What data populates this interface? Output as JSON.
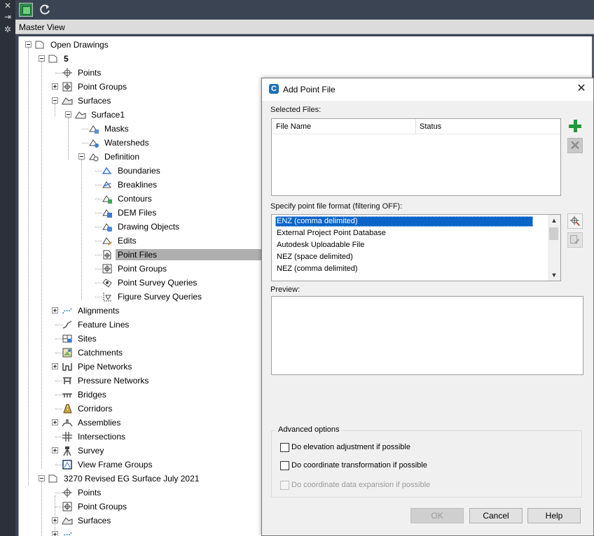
{
  "toolbar": {
    "icons": [
      "view-icon",
      "refresh-icon"
    ]
  },
  "master_view": {
    "title": "Master View"
  },
  "tree": {
    "open_drawings": "Open Drawings",
    "drawing1": "5",
    "points": "Points",
    "point_groups": "Point Groups",
    "surfaces": "Surfaces",
    "surface1": "Surface1",
    "masks": "Masks",
    "watersheds": "Watersheds",
    "definition": "Definition",
    "boundaries": "Boundaries",
    "breaklines": "Breaklines",
    "contours": "Contours",
    "dem_files": "DEM Files",
    "drawing_objects": "Drawing Objects",
    "edits": "Edits",
    "point_files": "Point Files",
    "def_point_groups": "Point Groups",
    "point_survey_queries": "Point Survey Queries",
    "figure_survey_queries": "Figure Survey Queries",
    "alignments": "Alignments",
    "feature_lines": "Feature Lines",
    "sites": "Sites",
    "catchments": "Catchments",
    "pipe_networks": "Pipe Networks",
    "pressure_networks": "Pressure Networks",
    "bridges": "Bridges",
    "corridors": "Corridors",
    "assemblies": "Assemblies",
    "intersections": "Intersections",
    "survey": "Survey",
    "view_frame_groups": "View Frame Groups",
    "drawing2": "3270 Revised EG Surface July 2021",
    "d2_points": "Points",
    "d2_point_groups": "Point Groups",
    "d2_surfaces": "Surfaces"
  },
  "dialog": {
    "title": "Add Point File",
    "selected_files_label": "Selected Files:",
    "col_file_name": "File Name",
    "col_status": "Status",
    "format_label": "Specify point file format (filtering OFF):",
    "formats": [
      "ENZ (comma delimited)",
      "External Project Point Database",
      "Autodesk Uploadable File",
      "NEZ (space delimited)",
      "NEZ (comma delimited)"
    ],
    "selected_format": "ENZ (comma delimited)",
    "preview_label": "Preview:",
    "advanced_label": "Advanced options",
    "opt_elevation": "Do elevation adjustment if possible",
    "opt_coord_transform": "Do coordinate transformation if possible",
    "opt_coord_expansion": "Do coordinate data expansion if possible",
    "ok": "OK",
    "cancel": "Cancel",
    "help": "Help"
  },
  "colors": {
    "selection": "#0a64c8",
    "tree_selection": "#aeaeae",
    "add_green": "#1f9a3b",
    "chrome_dark": "#3b4453"
  }
}
